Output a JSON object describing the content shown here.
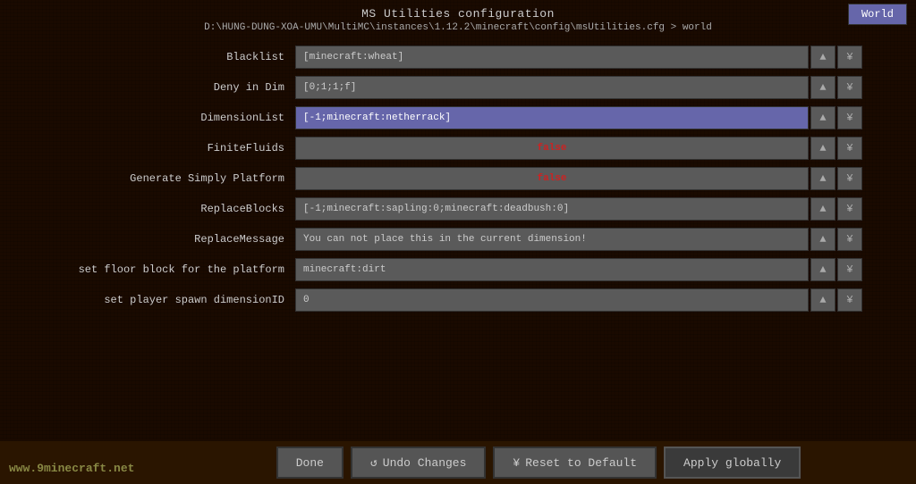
{
  "window": {
    "title": "MS Utilities configuration",
    "path": "D:\\HUNG-DUNG-XOA-UMU\\MultiMC\\instances\\1.12.2\\minecraft\\config\\msUtilities.cfg > world"
  },
  "tabs": [
    {
      "label": "World",
      "active": true
    }
  ],
  "rows": [
    {
      "label": "Blacklist",
      "value": "[minecraft:wheat]",
      "highlight": false,
      "red": false
    },
    {
      "label": "Deny in Dim",
      "value": "[0;1;1;f]",
      "highlight": false,
      "red": false
    },
    {
      "label": "DimensionList",
      "value": "[-1;minecraft:netherrack]",
      "highlight": true,
      "red": false
    },
    {
      "label": "FiniteFluids",
      "value": "false",
      "highlight": false,
      "red": true
    },
    {
      "label": "Generate Simply Platform",
      "value": "false",
      "highlight": false,
      "red": true
    },
    {
      "label": "ReplaceBlocks",
      "value": "[-1;minecraft:sapling:0;minecraft:deadbush:0]",
      "highlight": false,
      "red": false
    },
    {
      "label": "ReplaceMessage",
      "value": "You can not place this in the current dimension!",
      "highlight": false,
      "red": false
    },
    {
      "label": "set floor block for the platform",
      "value": "minecraft:dirt",
      "highlight": false,
      "red": false
    },
    {
      "label": "set player spawn dimensionID",
      "value": "0",
      "highlight": false,
      "red": false
    }
  ],
  "footer": {
    "done_label": "Done",
    "undo_icon": "↺",
    "undo_label": "Undo Changes",
    "reset_icon": "¥",
    "reset_label": "Reset to Default",
    "apply_label": "Apply globally"
  },
  "watermark": "www.9minecraft.net",
  "icons": {
    "up": "▲",
    "edit": "¥"
  }
}
